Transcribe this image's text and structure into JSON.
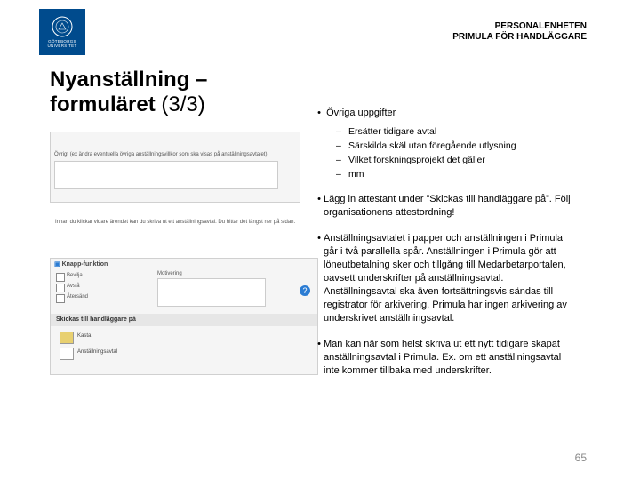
{
  "header": {
    "line1": "PERSONALENHETEN",
    "line2": "PRIMULA FÖR HANDLÄGGARE",
    "logo_line1": "GÖTEBORGS",
    "logo_line2": "UNIVERSITET"
  },
  "title_line1": "Nyanställning –",
  "title_line2": "formuläret ",
  "title_part": "(3/3)",
  "form_sketch": {
    "ovrigt_label": "Övrigt (ex ändra eventuella övriga anställningsvillkor som ska visas på anställningsavtalet).",
    "info_line": "Innan du klickar vidare ärendet kan du skriva ut ett anställningsavtal. Du hittar det längst ner på sidan.",
    "panel_title": "Knapp-funktion",
    "cb1": "Bevilja",
    "cb2": "Avslå",
    "cb3": "Återsänd",
    "mot_label": "Motivering",
    "bar_label": "Skickas till handläggare på",
    "i1": "Kasta",
    "i2": "Anställningsavtal"
  },
  "bullets": {
    "b1": "Övriga uppgifter",
    "s1": "Ersätter tidigare avtal",
    "s2": "Särskilda skäl utan föregående utlysning",
    "s3": "Vilket forskningsprojekt det gäller",
    "s4": "mm",
    "b2": "Lägg in attestant under ”Skickas till handläggare på”. Följ organisationens attestordning!",
    "b3": "Anställningsavtalet i papper och anställningen i Primula går i två parallella spår. Anställningen i Primula gör att löneutbetalning sker och tillgång till Medarbetarportalen, oavsett underskrifter på anställningsavtal. Anställningsavtal ska även fortsättningsvis sändas till registrator för arkivering. Primula har ingen arkivering av underskrivet anställningsavtal.",
    "b4": "Man kan när som helst skriva ut ett nytt tidigare skapat anställningsavtal i Primula. Ex. om ett anställningsavtal inte kommer tillbaka med underskrifter."
  },
  "page_number": "65"
}
